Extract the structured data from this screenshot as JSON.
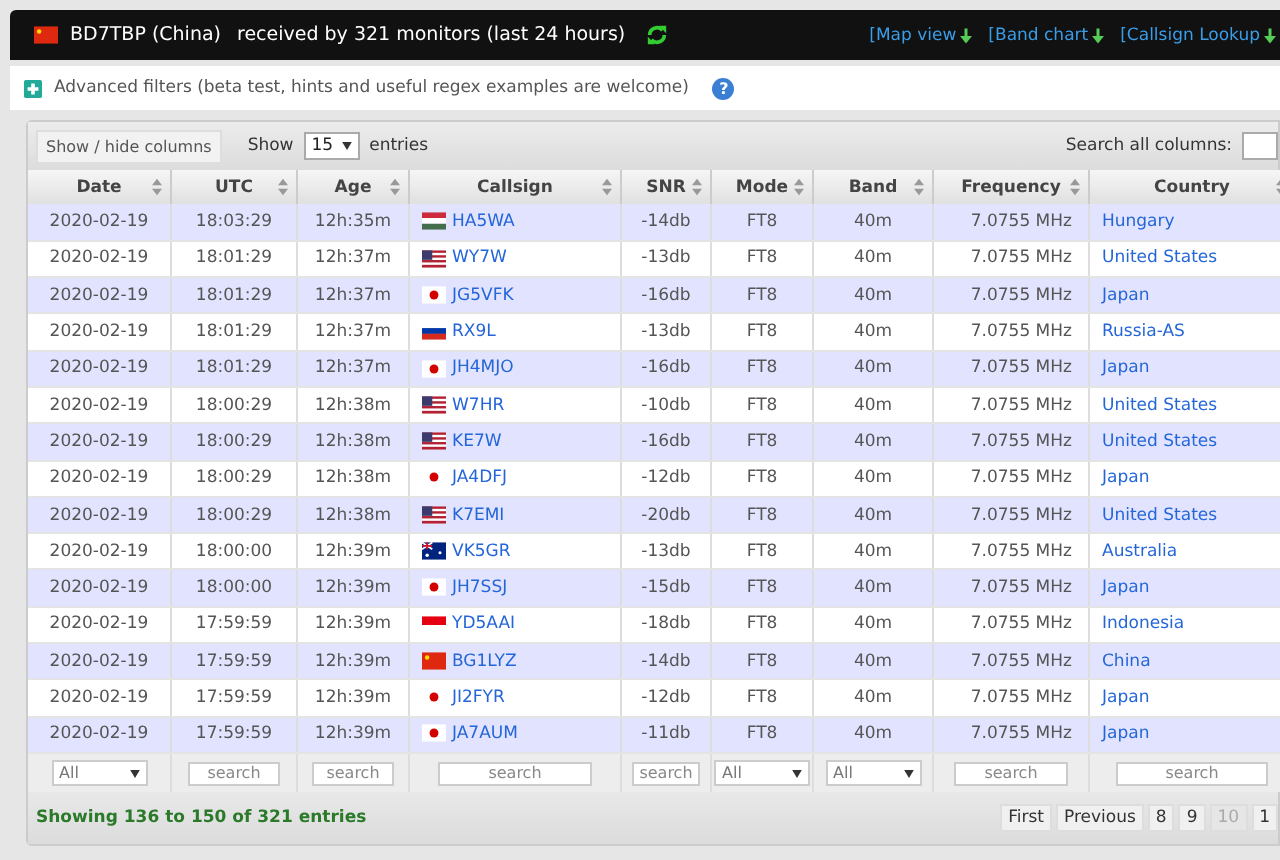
{
  "header": {
    "flag": {
      "kind": "cn"
    },
    "title": "BD7TBP (China)",
    "subtitle": "received by 321 monitors (last 24 hours)",
    "links": [
      "[Map view",
      "[Band chart",
      "[Callsign Lookup"
    ]
  },
  "filters": {
    "label": "Advanced filters (beta test, hints and useful regex examples are welcome)",
    "help": "?"
  },
  "toolbar": {
    "columns_button": "Show / hide columns",
    "show_label": "Show",
    "page_size": "15",
    "entries_label": "entries",
    "search_label": "Search all columns:"
  },
  "table": {
    "columns": [
      "Date",
      "UTC",
      "Age",
      "Callsign",
      "SNR",
      "Mode",
      "Band",
      "Frequency",
      "Country"
    ],
    "rows": [
      {
        "date": "2020-02-19",
        "utc": "18:03:29",
        "age": "12h:35m",
        "flag": {
          "kind": "hu"
        },
        "callsign": "HA5WA",
        "snr": "-14db",
        "mode": "FT8",
        "band": "40m",
        "frequency": "7.0755 MHz",
        "country": "Hungary"
      },
      {
        "date": "2020-02-19",
        "utc": "18:01:29",
        "age": "12h:37m",
        "flag": {
          "kind": "us"
        },
        "callsign": "WY7W",
        "snr": "-13db",
        "mode": "FT8",
        "band": "40m",
        "frequency": "7.0755 MHz",
        "country": "United States"
      },
      {
        "date": "2020-02-19",
        "utc": "18:01:29",
        "age": "12h:37m",
        "flag": {
          "kind": "jp"
        },
        "callsign": "JG5VFK",
        "snr": "-16db",
        "mode": "FT8",
        "band": "40m",
        "frequency": "7.0755 MHz",
        "country": "Japan"
      },
      {
        "date": "2020-02-19",
        "utc": "18:01:29",
        "age": "12h:37m",
        "flag": {
          "kind": "ru"
        },
        "callsign": "RX9L",
        "snr": "-13db",
        "mode": "FT8",
        "band": "40m",
        "frequency": "7.0755 MHz",
        "country": "Russia-AS"
      },
      {
        "date": "2020-02-19",
        "utc": "18:01:29",
        "age": "12h:37m",
        "flag": {
          "kind": "jp"
        },
        "callsign": "JH4MJO",
        "snr": "-16db",
        "mode": "FT8",
        "band": "40m",
        "frequency": "7.0755 MHz",
        "country": "Japan"
      },
      {
        "date": "2020-02-19",
        "utc": "18:00:29",
        "age": "12h:38m",
        "flag": {
          "kind": "us"
        },
        "callsign": "W7HR",
        "snr": "-10db",
        "mode": "FT8",
        "band": "40m",
        "frequency": "7.0755 MHz",
        "country": "United States"
      },
      {
        "date": "2020-02-19",
        "utc": "18:00:29",
        "age": "12h:38m",
        "flag": {
          "kind": "us"
        },
        "callsign": "KE7W",
        "snr": "-16db",
        "mode": "FT8",
        "band": "40m",
        "frequency": "7.0755 MHz",
        "country": "United States"
      },
      {
        "date": "2020-02-19",
        "utc": "18:00:29",
        "age": "12h:38m",
        "flag": {
          "kind": "jp"
        },
        "callsign": "JA4DFJ",
        "snr": "-12db",
        "mode": "FT8",
        "band": "40m",
        "frequency": "7.0755 MHz",
        "country": "Japan"
      },
      {
        "date": "2020-02-19",
        "utc": "18:00:29",
        "age": "12h:38m",
        "flag": {
          "kind": "us"
        },
        "callsign": "K7EMI",
        "snr": "-20db",
        "mode": "FT8",
        "band": "40m",
        "frequency": "7.0755 MHz",
        "country": "United States"
      },
      {
        "date": "2020-02-19",
        "utc": "18:00:00",
        "age": "12h:39m",
        "flag": {
          "kind": "au"
        },
        "callsign": "VK5GR",
        "snr": "-13db",
        "mode": "FT8",
        "band": "40m",
        "frequency": "7.0755 MHz",
        "country": "Australia"
      },
      {
        "date": "2020-02-19",
        "utc": "18:00:00",
        "age": "12h:39m",
        "flag": {
          "kind": "jp"
        },
        "callsign": "JH7SSJ",
        "snr": "-15db",
        "mode": "FT8",
        "band": "40m",
        "frequency": "7.0755 MHz",
        "country": "Japan"
      },
      {
        "date": "2020-02-19",
        "utc": "17:59:59",
        "age": "12h:39m",
        "flag": {
          "kind": "id"
        },
        "callsign": "YD5AAI",
        "snr": "-18db",
        "mode": "FT8",
        "band": "40m",
        "frequency": "7.0755 MHz",
        "country": "Indonesia"
      },
      {
        "date": "2020-02-19",
        "utc": "17:59:59",
        "age": "12h:39m",
        "flag": {
          "kind": "cn"
        },
        "callsign": "BG1LYZ",
        "snr": "-14db",
        "mode": "FT8",
        "band": "40m",
        "frequency": "7.0755 MHz",
        "country": "China"
      },
      {
        "date": "2020-02-19",
        "utc": "17:59:59",
        "age": "12h:39m",
        "flag": {
          "kind": "jp"
        },
        "callsign": "JI2FYR",
        "snr": "-12db",
        "mode": "FT8",
        "band": "40m",
        "frequency": "7.0755 MHz",
        "country": "Japan"
      },
      {
        "date": "2020-02-19",
        "utc": "17:59:59",
        "age": "12h:39m",
        "flag": {
          "kind": "jp"
        },
        "callsign": "JA7AUM",
        "snr": "-11db",
        "mode": "FT8",
        "band": "40m",
        "frequency": "7.0755 MHz",
        "country": "Japan"
      }
    ],
    "column_filters": [
      {
        "kind": "select",
        "value": "All"
      },
      {
        "kind": "search",
        "placeholder": "search"
      },
      {
        "kind": "search",
        "placeholder": "search"
      },
      {
        "kind": "search",
        "placeholder": "search"
      },
      {
        "kind": "search",
        "placeholder": "search"
      },
      {
        "kind": "select",
        "value": "All"
      },
      {
        "kind": "select",
        "value": "All"
      },
      {
        "kind": "search",
        "placeholder": "search"
      },
      {
        "kind": "search",
        "placeholder": "search"
      }
    ]
  },
  "status": {
    "info": "Showing 136 to 150 of 321 entries",
    "pages": [
      {
        "label": "First",
        "selected": false
      },
      {
        "label": "Previous",
        "selected": false
      },
      {
        "label": "8",
        "selected": false
      },
      {
        "label": "9",
        "selected": false
      },
      {
        "label": "10",
        "selected": true
      },
      {
        "label": "1",
        "selected": false
      }
    ]
  }
}
